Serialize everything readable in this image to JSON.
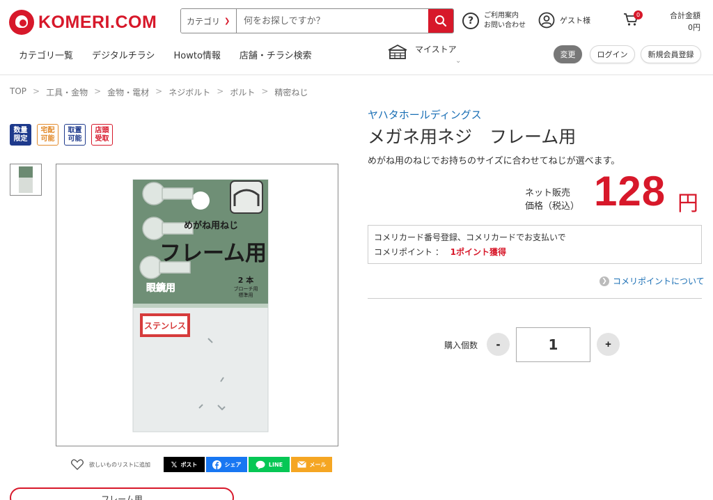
{
  "header": {
    "logo_text": "KOMERI.COM",
    "search": {
      "category_label": "カテゴリ",
      "placeholder": "何をお探しですか？"
    },
    "help": {
      "line1": "ご利用案内",
      "line2": "お問い合わせ"
    },
    "guest_label": "ゲスト様",
    "cart_count": "0",
    "total": {
      "label": "合計金額",
      "value": "0円"
    },
    "nav": [
      "カテゴリ一覧",
      "デジタルチラシ",
      "Howto情報",
      "店舗・チラシ検索"
    ],
    "mystore_label": "マイストア",
    "change_label": "変更",
    "login_label": "ログイン",
    "register_label": "新規会員登録"
  },
  "breadcrumb": [
    "TOP",
    "工具・金物",
    "金物・電材",
    "ネジボルト",
    "ボルト",
    "精密ねじ"
  ],
  "badges": [
    {
      "l1": "数量",
      "l2": "限定"
    },
    {
      "l1": "宅配",
      "l2": "可能"
    },
    {
      "l1": "取置",
      "l2": "可能"
    },
    {
      "l1": "店頭",
      "l2": "受取"
    }
  ],
  "product": {
    "maker": "ヤハタホールディングス",
    "title": "メガネ用ネジ　フレーム用",
    "description": "めがね用のねじでお持ちのサイズに合わせてねじが選べます。",
    "price_label_1": "ネット販売",
    "price_label_2": "価格（税込）",
    "price": "128",
    "price_unit": "円",
    "point_line1": "コメリカード番号登録、コメリカードでお支払いで",
    "point_label": "コメリポイント ：",
    "point_value": "1ポイント獲得",
    "point_link": "コメリポイントについて",
    "quantity_label": "購入個数",
    "quantity": "1",
    "minus_label": "-",
    "plus_label": "+"
  },
  "package": {
    "top_label": "めがね用ねじ",
    "main_label": "フレーム用",
    "sub_label": "眼鏡用",
    "count": "2 本",
    "count_note1": "ブローチ用",
    "count_note2": "標準用",
    "material": "ステンレス"
  },
  "wishlist_label": "欲しいものリストに追加",
  "share": {
    "x": "ポスト",
    "facebook": "シェア",
    "line": "LINE",
    "mail": "メール"
  },
  "bottom_button_label": "フレーム用"
}
